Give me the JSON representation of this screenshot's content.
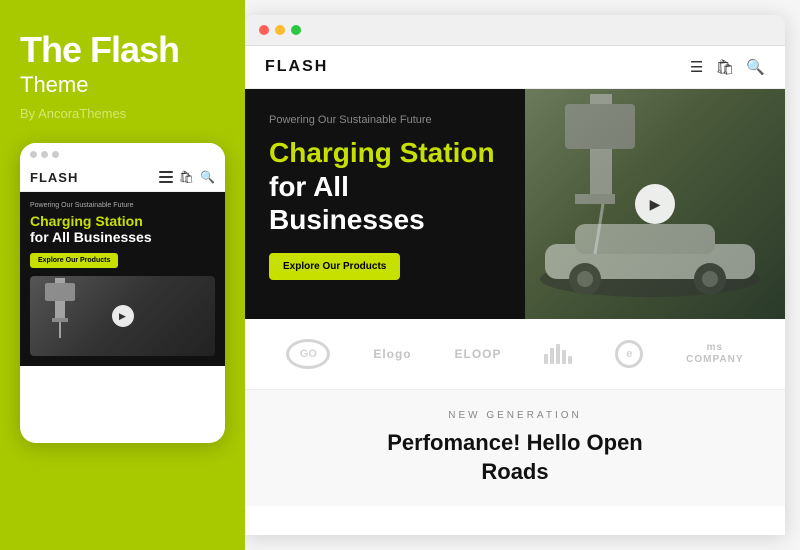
{
  "left": {
    "title": "The Flash",
    "subtitle": "Theme",
    "by": "By AncoraThemes",
    "mobile": {
      "logo": "FLASH",
      "hero_small": "Powering Our Sustainable Future",
      "hero_title_green": "Charging Station",
      "hero_title_white": "for All Businesses",
      "cta_label": "Explore Our Products"
    }
  },
  "site": {
    "logo": "FLASH",
    "hero": {
      "small_text": "Powering Our Sustainable Future",
      "title_green": "Charging",
      "title_green2": "Station",
      "title_white": "for All",
      "title_white2": "Businesses",
      "cta_label": "Explore Our Products"
    },
    "logos": [
      {
        "id": "go",
        "label": "GO"
      },
      {
        "id": "elogo",
        "label": "Elogo"
      },
      {
        "id": "eloop",
        "label": "ELOOP"
      },
      {
        "id": "bars",
        "label": ""
      },
      {
        "id": "e-circle",
        "label": ""
      },
      {
        "id": "company",
        "label": "COMPANY"
      }
    ],
    "content": {
      "tag": "NEW GENERATION",
      "title_line1": "Perfomance! Hello Open",
      "title_line2": "Roads"
    }
  }
}
